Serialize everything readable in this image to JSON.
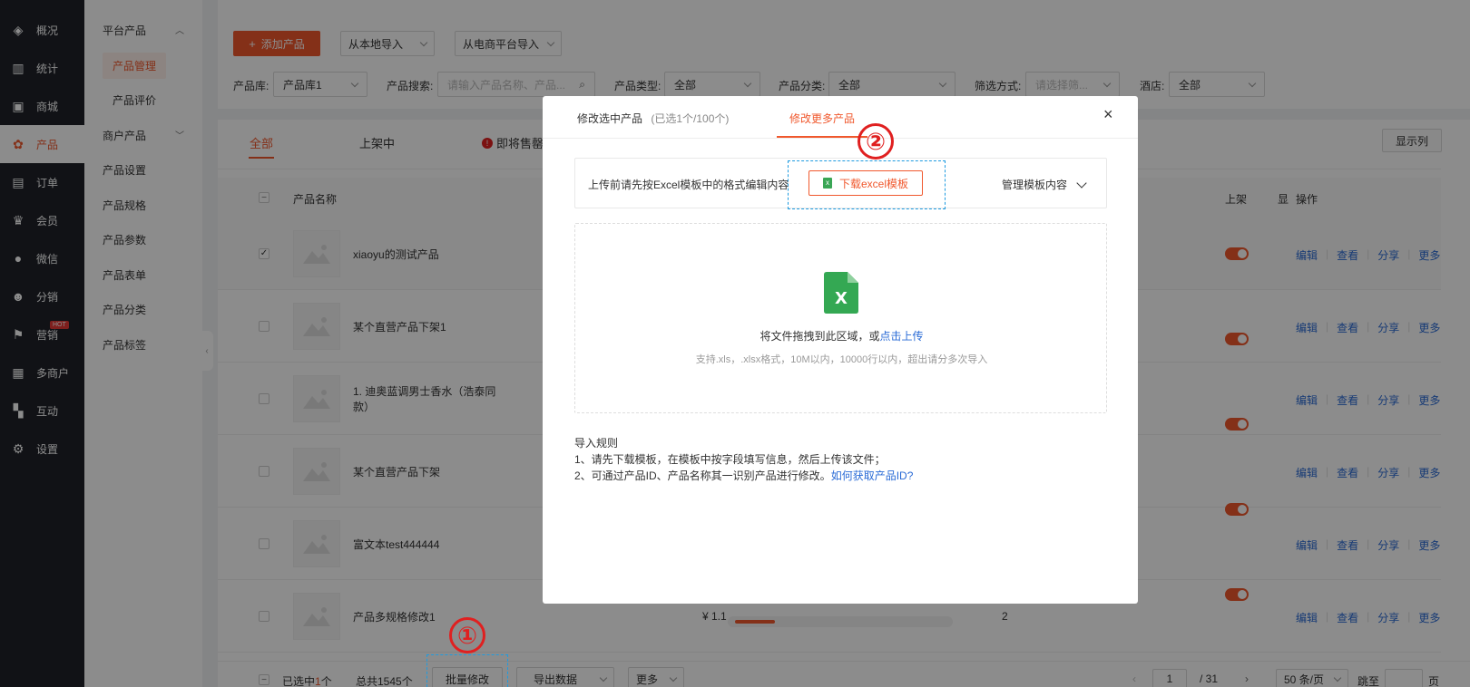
{
  "nav": {
    "items": [
      {
        "label": "概况",
        "icon": "layers-icon"
      },
      {
        "label": "统计",
        "icon": "chart-icon"
      },
      {
        "label": "商城",
        "icon": "shop-icon"
      },
      {
        "label": "产品",
        "icon": "product-icon",
        "active": true
      },
      {
        "label": "订单",
        "icon": "order-icon"
      },
      {
        "label": "会员",
        "icon": "crown-icon"
      },
      {
        "label": "微信",
        "icon": "wechat-icon"
      },
      {
        "label": "分销",
        "icon": "distribution-icon"
      },
      {
        "label": "营销",
        "icon": "flag-icon",
        "badge": "HOT"
      },
      {
        "label": "多商户",
        "icon": "merchant-icon"
      },
      {
        "label": "互动",
        "icon": "interact-icon"
      },
      {
        "label": "设置",
        "icon": "gear-icon"
      }
    ]
  },
  "subnav": {
    "group1": "平台产品",
    "manage": "产品管理",
    "review": "产品评价",
    "group2": "商户产品",
    "settings": "产品设置",
    "spec": "产品规格",
    "params": "产品参数",
    "form": "产品表单",
    "category": "产品分类",
    "tags": "产品标签"
  },
  "toolbar": {
    "add": "添加产品",
    "import_local": "从本地导入",
    "import_ecom": "从电商平台导入"
  },
  "filters": {
    "lib_label": "产品库:",
    "lib_value": "产品库1",
    "search_label": "产品搜索:",
    "search_placeholder": "请输入产品名称、产品...",
    "type_label": "产品类型:",
    "type_value": "全部",
    "cat_label": "产品分类:",
    "cat_value": "全部",
    "filter_label": "筛选方式:",
    "filter_placeholder": "请选择筛...",
    "hotel_label": "酒店:",
    "hotel_value": "全部"
  },
  "tabs": {
    "all": "全部",
    "on": "上架中",
    "expiring": "即将售罄",
    "columns": "显示列"
  },
  "table": {
    "col_name": "产品名称",
    "col_on": "上架",
    "col_show": "显",
    "col_ops": "操作",
    "ops": [
      "编辑",
      "查看",
      "分享",
      "更多"
    ],
    "rows": [
      {
        "name": "xiaoyu的测试产品",
        "checked": true
      },
      {
        "name": "某个直营产品下架1"
      },
      {
        "name": "1. 迪奥蓝调男士香水（浩泰同款）"
      },
      {
        "name": "某个直营产品下架"
      },
      {
        "name": "富文本test444444"
      },
      {
        "name": "产品多规格修改1",
        "price": "¥ 1.1",
        "stock": "2"
      }
    ]
  },
  "footer": {
    "selected_prefix": "已选中",
    "selected_count": "1",
    "selected_suffix": "个",
    "total": "总共1545个",
    "batch_edit": "批量修改",
    "export": "导出数据",
    "more": "更多",
    "page": "1",
    "pages": "/ 31",
    "page_size": "50 条/页",
    "jump": "跳至",
    "page_unit": "页"
  },
  "modal": {
    "tab1": "修改选中产品",
    "tab1_note": "(已选1个/100个)",
    "tab2": "修改更多产品",
    "notice": "上传前请先按Excel模板中的格式编辑内容",
    "download": "下载excel模板",
    "manage": "管理模板内容",
    "drop_text": "将文件拖拽到此区域，或",
    "drop_link": "点击上传",
    "drop_hint": "支持.xls，.xlsx格式，10M以内，10000行以内，超出请分多次导入",
    "rules_title": "导入规则",
    "rule1": "1、请先下载模板，在模板中按字段填写信息，然后上传该文件；",
    "rule2": "2、可通过产品ID、产品名称其一识别产品进行修改。",
    "rule2_link": "如何获取产品ID?"
  },
  "annotations": {
    "one": "①",
    "two": "②"
  },
  "colors": {
    "accent": "#f0582d",
    "nav_bg": "#1f2229",
    "link": "#2a6bd6",
    "annotation": "#e02020"
  }
}
